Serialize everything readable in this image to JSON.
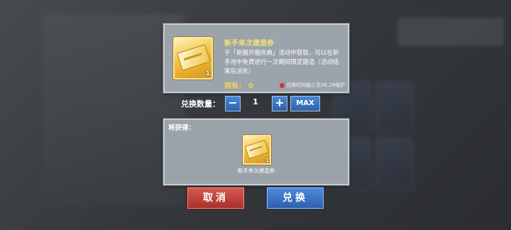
{
  "item": {
    "title": "新手单次建造券",
    "description": "于「新服开服庆典」活动中获取，可以在新手池中免费进行一次期间限定建造（活动结束后消失）",
    "owned_label": "拥有：",
    "owned_value": "0",
    "expiry": "兑换时间截止至06.29维护",
    "icon_count": "1",
    "icon": "build-ticket-icon"
  },
  "quantity": {
    "label": "兑换数量：",
    "minus": "−",
    "value": "1",
    "plus": "+",
    "max": "MAX"
  },
  "result": {
    "label": "将获得：",
    "icon_count": "1",
    "item_name": "新手单次建造券"
  },
  "buttons": {
    "cancel": "取消",
    "confirm": "兑换"
  },
  "colors": {
    "accent_blue": "#2f62a8",
    "cancel_red": "#a8302a",
    "title_gold": "#f2e07a"
  }
}
